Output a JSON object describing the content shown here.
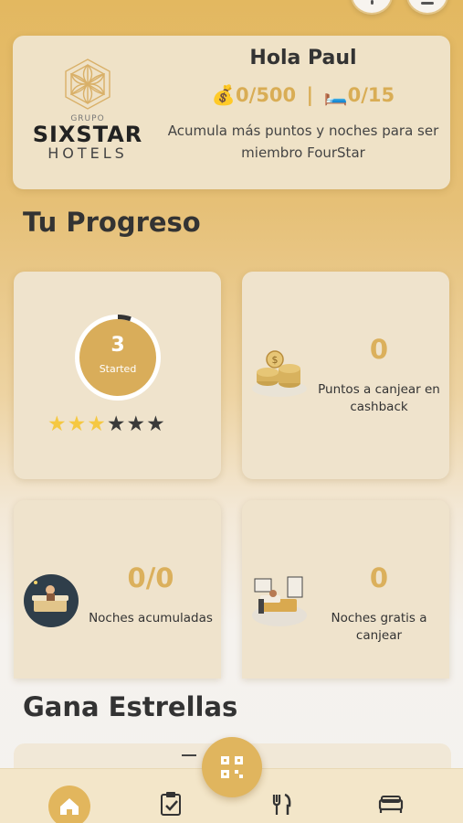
{
  "hero": {
    "logo": {
      "grupo": "GRUPO",
      "brand": "SIXSTAR",
      "hotels": "HOTELS"
    },
    "greeting": "Hola Paul",
    "points": "💰0/500",
    "separator": "|",
    "nights": "🛏️0/15",
    "message": "Acumula más puntos y noches para ser miembro FourStar"
  },
  "progress": {
    "title": "Tu Progreso",
    "level": {
      "value": "3",
      "label": "Started",
      "stars_filled": 3,
      "stars_total": 6
    },
    "cashback": {
      "value": "0",
      "label": "Puntos a canjear en cashback"
    },
    "nights": {
      "value": "0/0",
      "label": "Noches acumuladas"
    },
    "free_nights": {
      "value": "0",
      "label": "Noches gratis a canjear"
    }
  },
  "earn": {
    "title": "Gana Estrellas"
  },
  "nav": {
    "items": [
      "home-icon",
      "tasks-icon",
      "restaurant-icon",
      "bed-icon"
    ],
    "fab": "qr-code-icon"
  },
  "colors": {
    "accent": "#e0b55e",
    "gold_text": "#dbb05c",
    "card": "#efe3cc"
  }
}
